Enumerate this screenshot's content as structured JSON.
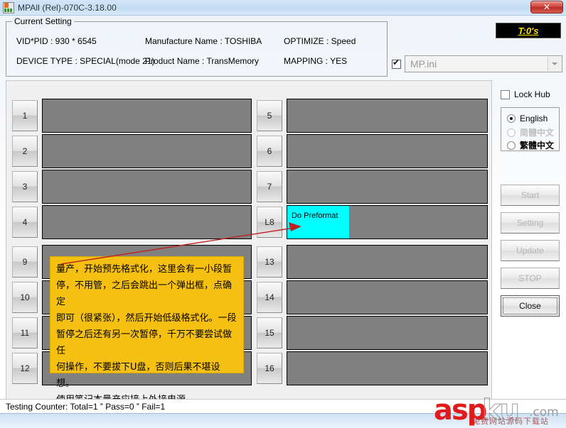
{
  "window": {
    "title": "MPAll (Rel)-070C-3.18.00",
    "close_label": "✕",
    "icon": "app-icon"
  },
  "current_setting": {
    "legend": "Current Setting",
    "vid_pid": "VID*PID :  930 * 6545",
    "device_type": "DEVICE TYPE : SPECIAL(mode 21)",
    "manufacture_name": "Manufacture Name : TOSHIBA",
    "product_name": "Product Name : TransMemory",
    "optimize": "OPTIMIZE : Speed",
    "mapping": "MAPPING : YES"
  },
  "counter_badge": {
    "text": "T:0's",
    "bg": "#000000",
    "fg": "#ffe400"
  },
  "ini_selector": {
    "checked": true,
    "value": "MP.ini",
    "enabled": false
  },
  "slots": {
    "left_top": [
      {
        "id": "1",
        "label": "",
        "progress": 0
      },
      {
        "id": "2",
        "label": "",
        "progress": 0
      },
      {
        "id": "3",
        "label": "",
        "progress": 0
      },
      {
        "id": "4",
        "label": "",
        "progress": 0
      }
    ],
    "right_top": [
      {
        "id": "5",
        "label": "",
        "progress": 0
      },
      {
        "id": "6",
        "label": "",
        "progress": 0
      },
      {
        "id": "7",
        "label": "",
        "progress": 0
      },
      {
        "id": "L8",
        "label": "Do Preformat",
        "progress": 31
      }
    ],
    "left_bottom": [
      {
        "id": "9",
        "label": "",
        "progress": 0
      },
      {
        "id": "10",
        "label": "",
        "progress": 0
      },
      {
        "id": "11",
        "label": "",
        "progress": 0
      },
      {
        "id": "12",
        "label": "",
        "progress": 0
      }
    ],
    "right_bottom": [
      {
        "id": "13",
        "label": "",
        "progress": 0
      },
      {
        "id": "14",
        "label": "",
        "progress": 0
      },
      {
        "id": "15",
        "label": "",
        "progress": 0
      },
      {
        "id": "16",
        "label": "",
        "progress": 0
      }
    ],
    "active_color": "#00ffff",
    "idle_color": "#808080"
  },
  "side_panel": {
    "lock_hub": {
      "label": "Lock Hub",
      "checked": false
    },
    "language": {
      "options": [
        {
          "label": "English",
          "selected": true,
          "disabled": false
        },
        {
          "label": "简體中文",
          "selected": false,
          "disabled": true
        },
        {
          "label": "繁體中文",
          "selected": false,
          "disabled": false
        }
      ]
    },
    "buttons": [
      {
        "label": "Start",
        "enabled": false
      },
      {
        "label": "Setting",
        "enabled": false
      },
      {
        "label": "Update",
        "enabled": false
      },
      {
        "label": "STOP",
        "enabled": false
      },
      {
        "label": "Close",
        "enabled": true,
        "focused": true
      }
    ]
  },
  "annotation": {
    "lines": [
      "量产，开始预先格式化，这里会有一小段暂",
      "停，不用管，之后会跳出一个弹出框，点确定",
      "即可（很紧张），然后开始低级格式化。一段",
      "暂停之后还有另一次暂停，千万不要尝试做任",
      "何操作，不要拔下U盘，否则后果不堪设想。",
      "使用笔记本量产应接上外接电源。"
    ],
    "bg": "#f5c011",
    "arrow_color": "#c02020"
  },
  "status_bar": {
    "text": "Testing Counter: Total=1 ˮ Pass=0 ˮ Fail=1"
  },
  "watermark": {
    "part_red": "asp",
    "part_gray": "ku",
    "domain": ".com",
    "subtitle": "免费网站源码下载站"
  }
}
